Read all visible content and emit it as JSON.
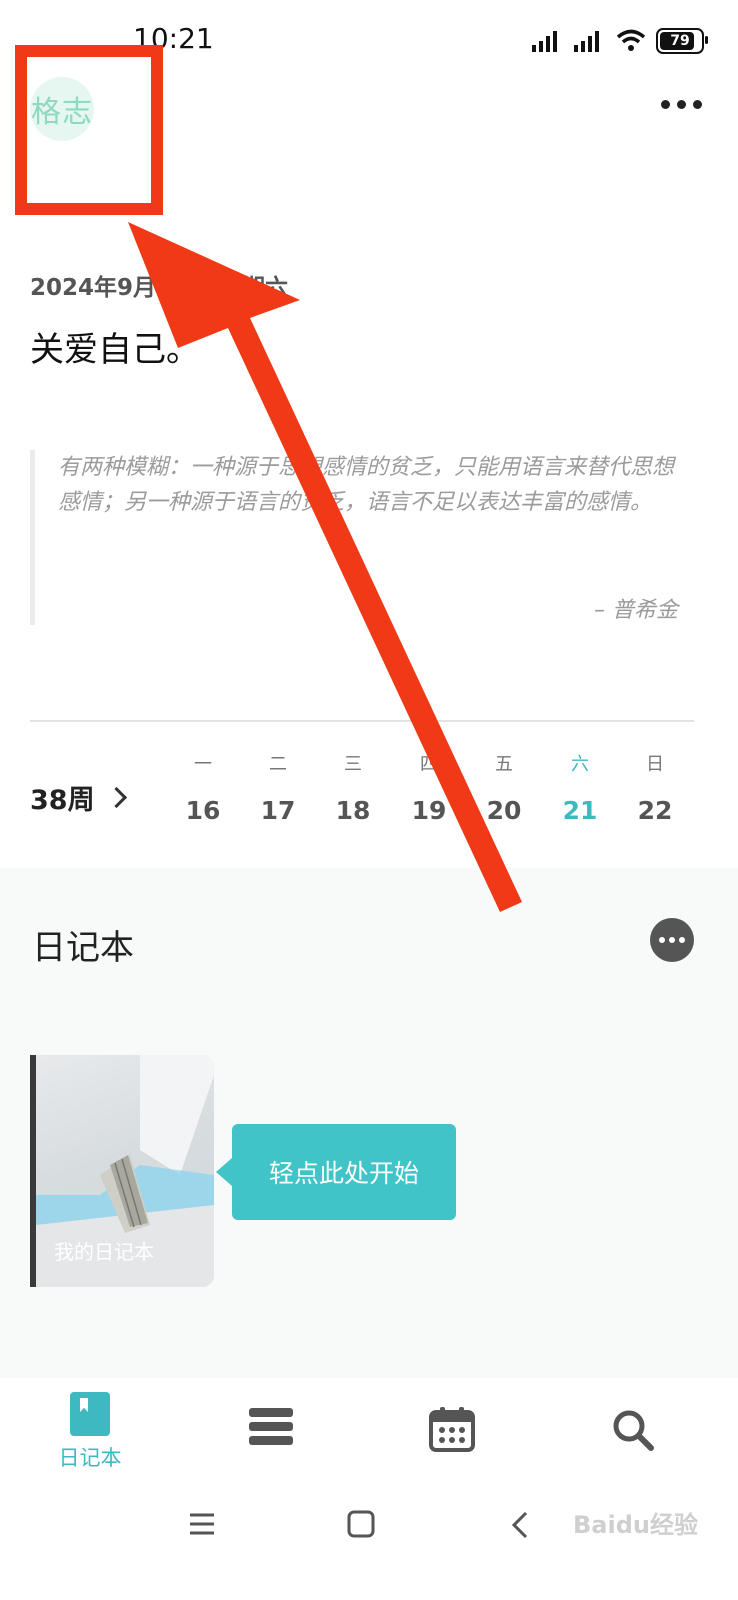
{
  "status_bar": {
    "time": "10:21",
    "battery": "79"
  },
  "header": {
    "logo_text": "格志"
  },
  "entry": {
    "date": "2024年9月21日 星期六",
    "title": "关爱自己。"
  },
  "quote": {
    "text": "有两种模糊：一种源于思想感情的贫乏，只能用语言来替代思想感情；另一种源于语言的贫乏，语言不足以表达丰富的感情。",
    "author": "– 普希金"
  },
  "week": {
    "label": "38周",
    "days": [
      {
        "name": "一",
        "num": "16"
      },
      {
        "name": "二",
        "num": "17"
      },
      {
        "name": "三",
        "num": "18"
      },
      {
        "name": "四",
        "num": "19"
      },
      {
        "name": "五",
        "num": "20"
      },
      {
        "name": "六",
        "num": "21"
      },
      {
        "name": "日",
        "num": "22"
      }
    ],
    "active_index": 5
  },
  "notebooks": {
    "section_title": "日记本",
    "items": [
      {
        "label": "我的日记本"
      }
    ],
    "hint": "轻点此处开始"
  },
  "bottom_nav": {
    "items": [
      {
        "label": "日记本",
        "icon": "notebook-icon",
        "active": true
      },
      {
        "label": "",
        "icon": "list-icon"
      },
      {
        "label": "",
        "icon": "calendar-icon"
      },
      {
        "label": "",
        "icon": "search-icon"
      }
    ]
  },
  "watermark": "Baidu经验",
  "colors": {
    "accent": "#3fb9c1",
    "hint_bubble": "#41c4c8",
    "annotation_red": "#f03a17"
  }
}
